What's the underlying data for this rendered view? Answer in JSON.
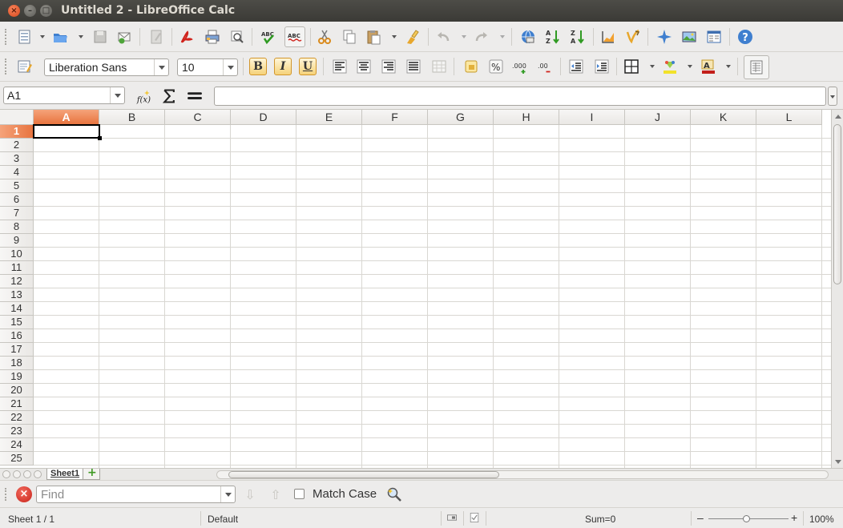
{
  "window": {
    "title": "Untitled 2 - LibreOffice Calc",
    "close_glyph": "×",
    "minimize_glyph": "–",
    "maximize_glyph": "□"
  },
  "standard_toolbar": {
    "icons": [
      "new-document-icon",
      "open-icon",
      "save-icon",
      "email-icon",
      "edit-file-icon",
      "export-pdf-icon",
      "print-icon",
      "print-preview-icon",
      "spellcheck-icon",
      "autospellcheck-icon",
      "cut-icon",
      "copy-icon",
      "paste-icon",
      "clone-formatting-icon",
      "undo-icon",
      "redo-icon",
      "hyperlink-icon",
      "sort-ascending-icon",
      "sort-descending-icon",
      "chart-icon",
      "draw-functions-icon",
      "navigator-icon",
      "gallery-icon",
      "data-sources-icon",
      "help-icon"
    ]
  },
  "formatting_toolbar": {
    "font_name": "Liberation Sans",
    "font_size": "10",
    "bold_label": "B",
    "italic_label": "I",
    "underline_label": "U"
  },
  "formula_bar": {
    "name_box": "A1",
    "formula": ""
  },
  "grid": {
    "columns": [
      "A",
      "B",
      "C",
      "D",
      "E",
      "F",
      "G",
      "H",
      "I",
      "J",
      "K",
      "L"
    ],
    "rows": [
      "1",
      "2",
      "3",
      "4",
      "5",
      "6",
      "7",
      "8",
      "9",
      "10",
      "11",
      "12",
      "13",
      "14",
      "15",
      "16",
      "17",
      "18",
      "19",
      "20",
      "21",
      "22",
      "23",
      "24",
      "25"
    ],
    "active_column": "A",
    "active_row": "1"
  },
  "sheet_tabs": {
    "tabs": [
      "Sheet1"
    ]
  },
  "find_bar": {
    "placeholder": "Find",
    "match_case_label": "Match Case"
  },
  "status_bar": {
    "sheet_info": "Sheet 1 / 1",
    "page_style": "Default",
    "sum": "Sum=0",
    "zoom": "100%",
    "zoom_minus": "–",
    "zoom_plus": "+"
  },
  "colors": {
    "accent_orange": "#e8743f",
    "title_bar": "#3b3a36"
  }
}
